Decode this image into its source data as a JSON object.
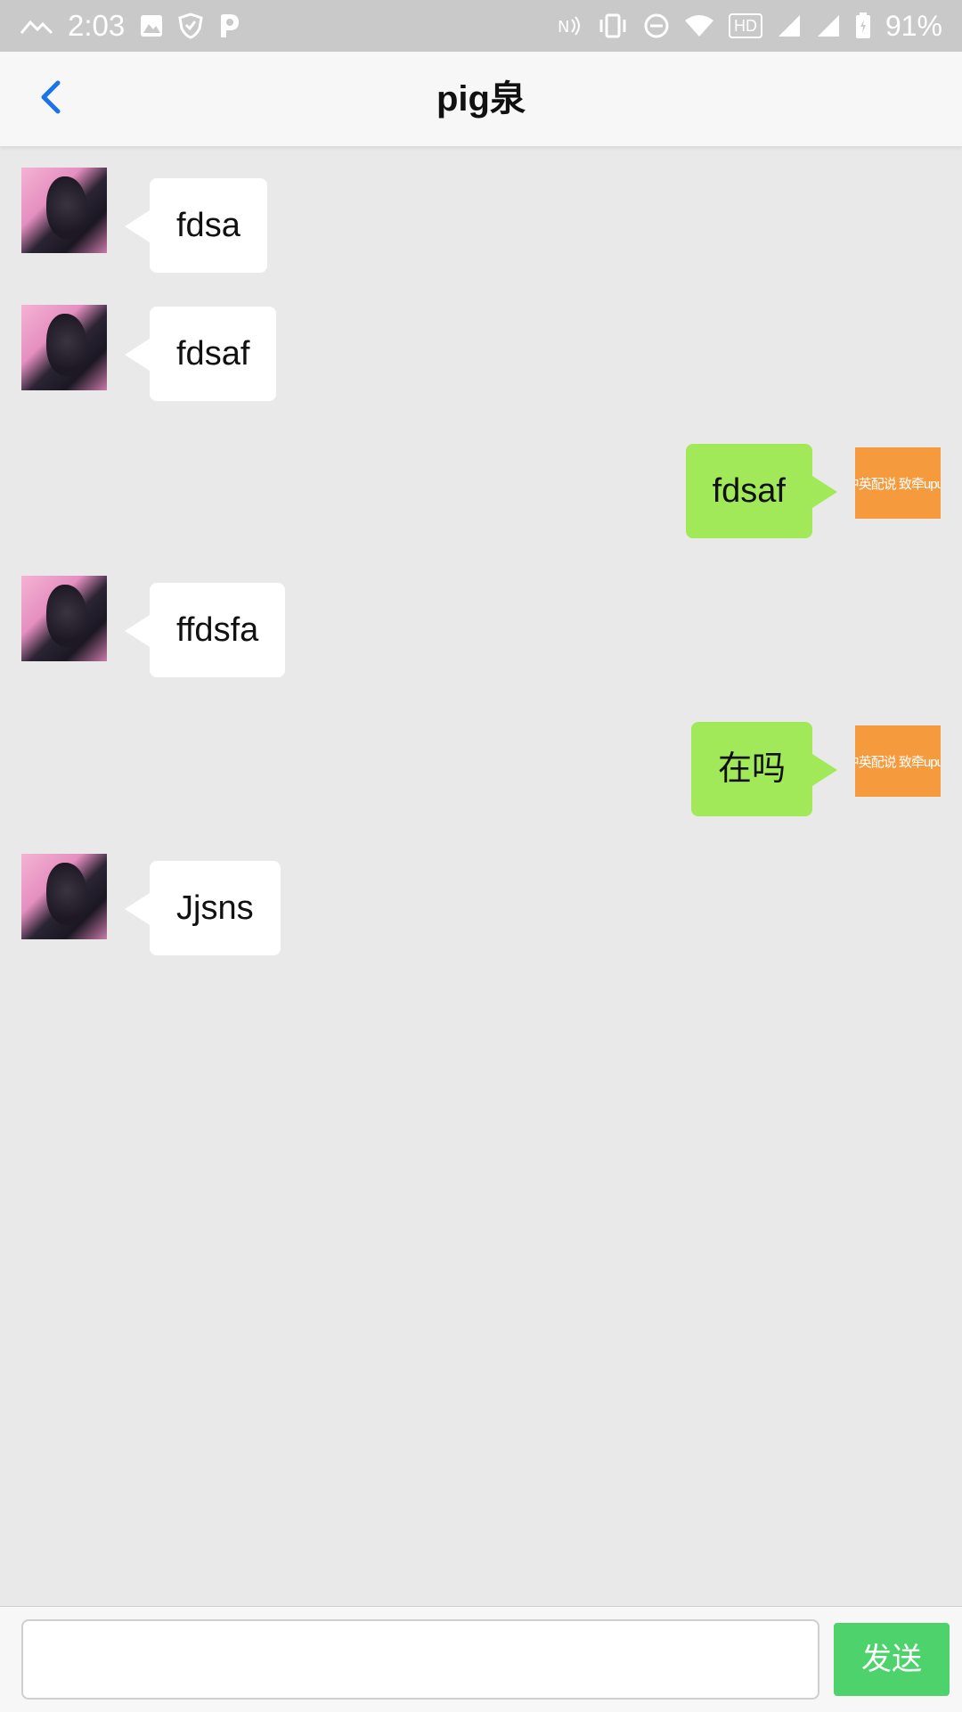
{
  "status_bar": {
    "time": "2:03",
    "battery": "91%",
    "hd": "HD",
    "left_icons": [
      "mountain-icon",
      "image-icon",
      "shield-icon",
      "p-icon"
    ],
    "right_icons": [
      "nfc-icon",
      "vibrate-icon",
      "dnd-icon",
      "wifi-icon",
      "hd-icon",
      "signal-icon",
      "signal-icon",
      "battery-icon"
    ]
  },
  "header": {
    "title": "pig泉",
    "back_icon": "chevron-left-icon",
    "accent": "#1a73e8"
  },
  "messages": [
    {
      "side": "left",
      "text": "fdsa"
    },
    {
      "side": "left",
      "text": "fdsaf"
    },
    {
      "side": "right",
      "text": "fdsaf"
    },
    {
      "side": "left",
      "text": "ffdsfa"
    },
    {
      "side": "right",
      "text": "在吗"
    },
    {
      "side": "left",
      "text": "Jjsns"
    }
  ],
  "my_avatar_text": "中英配说 致牵upup",
  "input": {
    "value": "",
    "placeholder": ""
  },
  "send_button_label": "发送",
  "colors": {
    "background": "#e9e9e9",
    "my_bubble": "#a2e95a",
    "other_bubble": "#ffffff",
    "send_button": "#4ed36c",
    "my_avatar": "#f59a3d"
  }
}
